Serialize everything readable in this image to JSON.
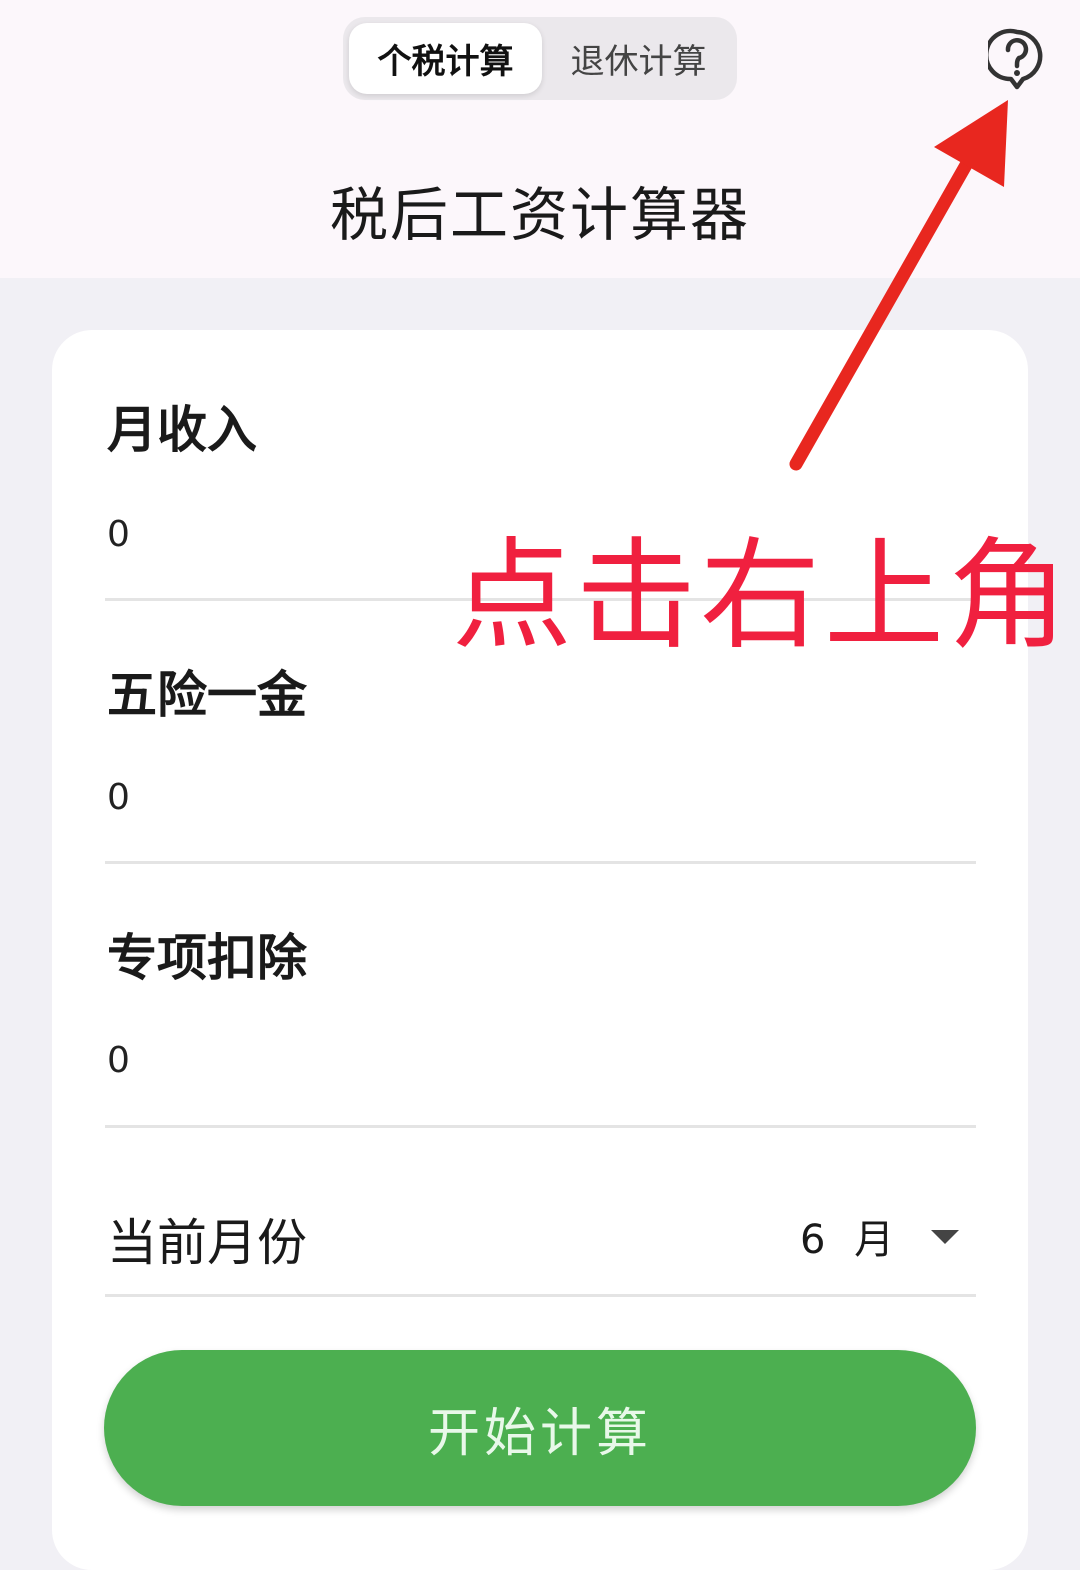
{
  "header": {
    "tabs": [
      {
        "label": "个税计算",
        "active": true
      },
      {
        "label": "退休计算",
        "active": false
      }
    ],
    "help_icon": "help-question-bubble-icon",
    "title": "税后工资计算器"
  },
  "form": {
    "monthly_income": {
      "label": "月收入",
      "value": "0"
    },
    "social_insurance": {
      "label": "五险一金",
      "value": "0"
    },
    "special_deduction": {
      "label": "专项扣除",
      "value": "0"
    },
    "current_month": {
      "label": "当前月份",
      "value": "6 月"
    }
  },
  "calculate_button": {
    "label": "开始计算"
  },
  "annotation": {
    "text": "点击右上角",
    "color": "#f0203f"
  },
  "colors": {
    "accent_green": "#4caf50",
    "header_bg": "#fcf7fb",
    "page_bg": "#f1f0f5",
    "annotation_red": "#f0203f"
  }
}
